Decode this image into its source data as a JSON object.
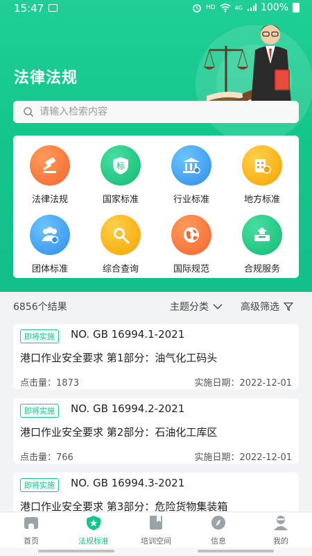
{
  "status_bar": {
    "time": "15:47",
    "network": "HD",
    "signal": "4G",
    "battery": "100%"
  },
  "header": {
    "title": "法律法规"
  },
  "search": {
    "placeholder": "请输入检索内容"
  },
  "categories": [
    {
      "label": "法律法规",
      "icon": "gavel-icon",
      "color": "#f2662f"
    },
    {
      "label": "国家标准",
      "icon": "shield-standard-icon",
      "color": "#19c27f"
    },
    {
      "label": "行业标准",
      "icon": "institution-icon",
      "color": "#2f93e8"
    },
    {
      "label": "地方标准",
      "icon": "building-icon",
      "color": "#f5a800"
    },
    {
      "label": "团体标准",
      "icon": "group-icon",
      "color": "#2f93e8"
    },
    {
      "label": "综合查询",
      "icon": "search-icon",
      "color": "#f5a800"
    },
    {
      "label": "国际规范",
      "icon": "globe-icon",
      "color": "#f2662f"
    },
    {
      "label": "合规服务",
      "icon": "inbox-icon",
      "color": "#19c27f"
    }
  ],
  "results": {
    "count_text": "6856个结果",
    "topic_filter": "主题分类",
    "advanced_filter": "高级筛选"
  },
  "items": [
    {
      "badge": "即将实施",
      "code": "NO. GB 16994.1-2021",
      "title": "港口作业安全要求 第1部分：油气化工码头",
      "clicks": "点击量：1873",
      "date": "实施日期：2022-12-01"
    },
    {
      "badge": "即将实施",
      "code": "NO. GB 16994.2-2021",
      "title": "港口作业安全要求 第2部分：石油化工库区",
      "clicks": "点击量：766",
      "date": "实施日期：2022-12-01"
    },
    {
      "badge": "即将实施",
      "code": "NO. GB 16994.3-2021",
      "title": "港口作业安全要求 第3部分：危险货物集装箱",
      "clicks": "",
      "date": ""
    }
  ],
  "tabbar": [
    {
      "label": "首页",
      "icon": "home-icon",
      "active": false
    },
    {
      "label": "法规标准",
      "icon": "star-shield-icon",
      "active": true
    },
    {
      "label": "培训空间",
      "icon": "bookmark-icon",
      "active": false
    },
    {
      "label": "信息",
      "icon": "compass-icon",
      "active": false
    },
    {
      "label": "我的",
      "icon": "user-icon",
      "active": false
    }
  ],
  "colors": {
    "brand": "#14c58b",
    "background": "#f1f3f4"
  }
}
